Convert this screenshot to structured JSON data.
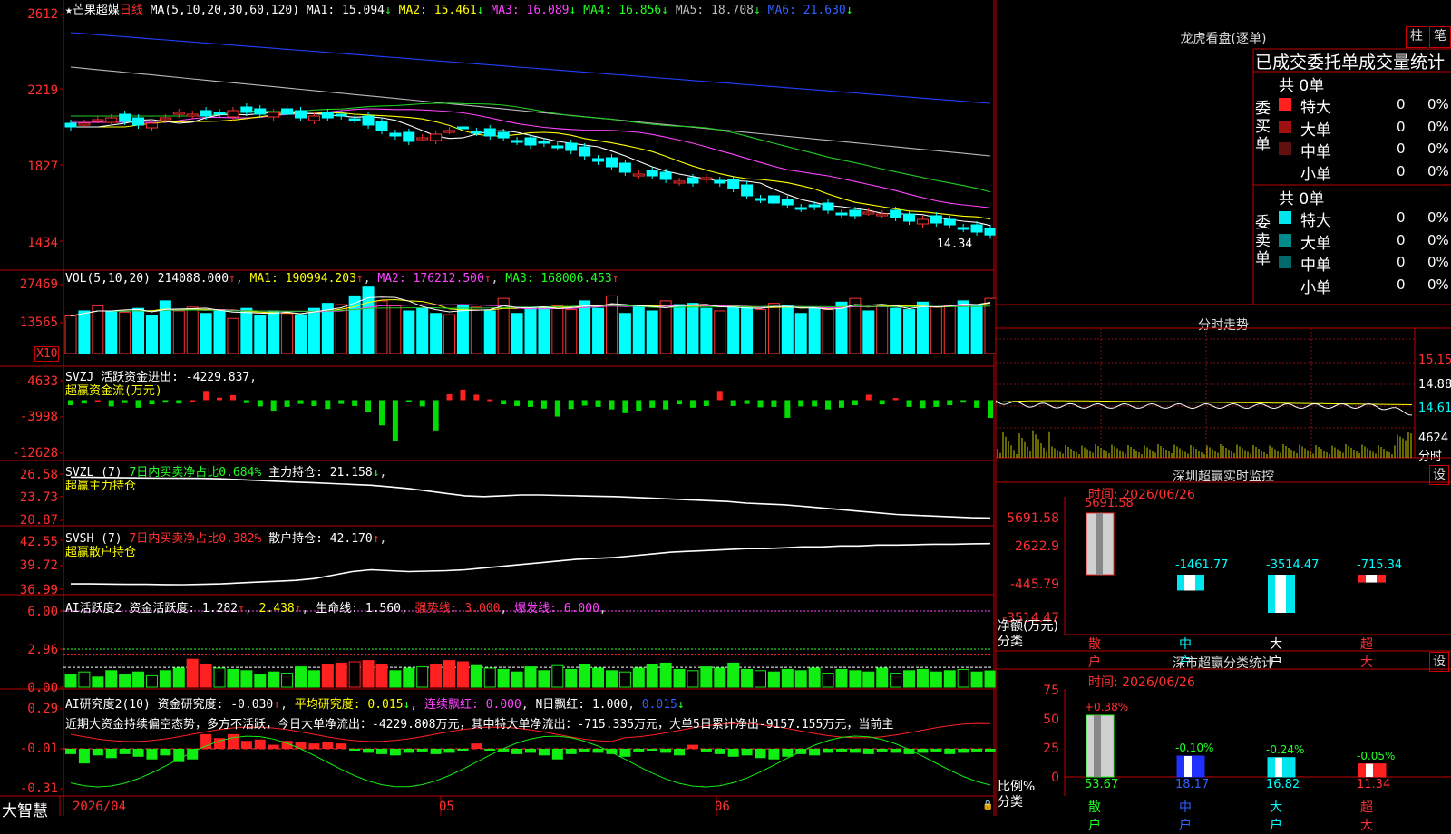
{
  "header": {
    "star": "★",
    "stock": "芒果超媒",
    "period": "日线",
    "ma_params": "MA(5,10,20,30,60,120)",
    "ma": [
      {
        "label": "MA1:",
        "value": "15.094",
        "arrow": "↓",
        "color": "#ffffff"
      },
      {
        "label": "MA2:",
        "value": "15.461",
        "arrow": "↓",
        "color": "#ffff00"
      },
      {
        "label": "MA3:",
        "value": "16.089",
        "arrow": "↓",
        "color": "#ff44ff"
      },
      {
        "label": "MA4:",
        "value": "16.856",
        "arrow": "↓",
        "color": "#22ff22"
      },
      {
        "label": "MA5:",
        "value": "18.708",
        "arrow": "↓",
        "color": "#bbbbbb"
      },
      {
        "label": "MA6:",
        "value": "21.630",
        "arrow": "↓",
        "color": "#3060ff"
      }
    ]
  },
  "price_axis": [
    "2612",
    "2219",
    "1827",
    "1434"
  ],
  "last_price_label": "14.34",
  "vol": {
    "title": "VOL(5,10,20)",
    "value": "214088.000",
    "ma1": "MA1: 190994.203",
    "ma2": "MA2: 176212.500",
    "ma3": "MA3: 168006.453",
    "axis": [
      "27469",
      "13565"
    ],
    "unit": "X10"
  },
  "svzj": {
    "title": "SVZJ",
    "line": "活跃资金进出: -4229.837",
    "sub": "超赢资金流(万元)",
    "axis": [
      "4633",
      "-3998",
      "-12628"
    ]
  },
  "svzl": {
    "title": "SVZL (7)",
    "pct": "7日内买卖净占比0.684%",
    "hold": "主力持仓: 21.158",
    "sub": "超赢主力持仓",
    "axis": [
      "26.58",
      "23.73",
      "20.87"
    ]
  },
  "svsh": {
    "title": "SVSH (7)",
    "pct": "7日内买卖净占比0.382%",
    "hold": "散户持仓: 42.170",
    "sub": "超赢散户持仓",
    "axis": [
      "42.55",
      "39.72",
      "36.99"
    ]
  },
  "ai_active": {
    "title": "AI活跃度2",
    "active": "资金活跃度: 1.282",
    "v2": "2.438",
    "life": "生命线: 1.560",
    "strong": "强势线: 3.000",
    "burst": "爆发线: 6.000",
    "axis": [
      "6.00",
      "2.96",
      "0.00"
    ]
  },
  "ai_research": {
    "title": "AI研究度2(10)",
    "research": "资金研究度: -0.030",
    "avg": "平均研究度: 0.015",
    "cont": "连续飘红: 0.000",
    "nday": "N日飘红: 1.000",
    "last": "0.015",
    "axis": [
      "0.29",
      "-0.01",
      "-0.31"
    ],
    "ticker": "近期大资金持续偏空态势，多方不活跃，今日大单净流出：-4229.808万元，其中特大单净流出：-715.335万元，大单5日累计净出-9157.155万元，当前主"
  },
  "xaxis": {
    "d1": "2026/04",
    "d2": "05",
    "d3": "06"
  },
  "logo": "大智慧",
  "right": {
    "lh_title": "龙虎看盘(逐单)",
    "btn_col": "柱",
    "btn_bi": "笔",
    "stat_title": "已成交委托单成交量统计",
    "buy_label": "委买单",
    "sell_label": "委卖单",
    "total": "共 0单",
    "buy_rows": [
      {
        "name": "特大",
        "n": "0",
        "p": "0%",
        "color": "#ff2020"
      },
      {
        "name": "大单",
        "n": "0",
        "p": "0%",
        "color": "#a01010"
      },
      {
        "name": "中单",
        "n": "0",
        "p": "0%",
        "color": "#601010"
      },
      {
        "name": "小单",
        "n": "0",
        "p": "0%",
        "color": "#000000"
      }
    ],
    "sell_rows": [
      {
        "name": "特大",
        "n": "0",
        "p": "0%",
        "color": "#00e5ee"
      },
      {
        "name": "大单",
        "n": "0",
        "p": "0%",
        "color": "#008c8c"
      },
      {
        "name": "中单",
        "n": "0",
        "p": "0%",
        "color": "#006a6a"
      },
      {
        "name": "小单",
        "n": "0",
        "p": "0%",
        "color": "#000000"
      }
    ],
    "intraday_title": "分时走势",
    "intraday_axis": [
      "15.15",
      "14.88",
      "14.61"
    ],
    "intraday_vol": "4624",
    "intraday_vol_label": "分时",
    "monitor_title": "深圳超赢实时监控",
    "monitor_btn": "设",
    "time_label": "时间: 2026/06/26",
    "monitor_axis": [
      "5691.58",
      "2622.9",
      "-445.79",
      "-3514.47"
    ],
    "net_label": "净额(万元)",
    "class_label": "分类",
    "monitor_values": [
      {
        "cat": "散户",
        "value": "5691.58"
      },
      {
        "cat": "中户",
        "value": "-1461.77"
      },
      {
        "cat": "大户",
        "value": "-3514.47"
      },
      {
        "cat": "超大",
        "value": "-715.34"
      }
    ],
    "class_title": "深市超赢分类统计",
    "class_btn": "设",
    "class_axis": [
      "75",
      "50",
      "25",
      "0"
    ],
    "ratio_label": "比例%",
    "class_values": [
      {
        "cat": "散户",
        "pct": "53.67",
        "chg": "+0.38%"
      },
      {
        "cat": "中户",
        "pct": "18.17",
        "chg": "-0.10%"
      },
      {
        "cat": "大户",
        "pct": "16.82",
        "chg": "-0.24%"
      },
      {
        "cat": "超大",
        "pct": "11.34",
        "chg": "-0.05%"
      }
    ]
  },
  "chart_data": [
    {
      "type": "candlestick",
      "title": "芒果超媒 日线",
      "ylim": [
        14.0,
        26.5
      ],
      "x_ticks": [
        "2026/04",
        "05",
        "06"
      ],
      "close": [
        20.3,
        20.5,
        20.7,
        20.8,
        20.6,
        20.4,
        20.5,
        20.8,
        21.1,
        21.0,
        20.9,
        21.0,
        21.2,
        21.1,
        21.0,
        21.1,
        21.0,
        20.8,
        20.9,
        20.8,
        20.9,
        20.7,
        20.4,
        20.1,
        19.8,
        19.5,
        19.7,
        19.9,
        20.1,
        20.2,
        20.0,
        19.8,
        19.7,
        19.5,
        19.3,
        19.4,
        19.2,
        19.0,
        18.7,
        18.4,
        18.1,
        17.8,
        17.7,
        17.6,
        17.4,
        17.3,
        17.2,
        17.5,
        17.2,
        16.9,
        16.5,
        16.3,
        16.1,
        16.0,
        15.8,
        15.9,
        15.7,
        15.5,
        15.4,
        15.6,
        15.5,
        15.3,
        15.1,
        15.2,
        15.0,
        14.9,
        14.7,
        14.5,
        14.34
      ],
      "ma": {
        "MA1": 15.094,
        "MA2": 15.461,
        "MA3": 16.089,
        "MA4": 16.856,
        "MA5": 18.708,
        "MA6": 21.63
      }
    },
    {
      "type": "bar",
      "title": "VOL(5,10,20)",
      "ylim": [
        0,
        27469
      ],
      "values": [
        15000,
        17000,
        19000,
        17000,
        16500,
        18000,
        15000,
        21000,
        17000,
        18500,
        16000,
        17500,
        14000,
        18000,
        15000,
        17000,
        16000,
        15500,
        18000,
        20000,
        19500,
        23000,
        26500,
        21000,
        19000,
        17000,
        18000,
        16000,
        15500,
        19000,
        18500,
        17000,
        22000,
        16000,
        18000,
        18500,
        19000,
        17500,
        21000,
        18000,
        23000,
        16000,
        19000,
        17000,
        21000,
        19500,
        20000,
        18000,
        17000,
        19000,
        18500,
        17500,
        20000,
        19000,
        16000,
        18000,
        17500,
        20500,
        22000,
        17000,
        19000,
        18000,
        17500,
        20500,
        18500,
        19000,
        21000,
        19500,
        22000
      ]
    },
    {
      "type": "bar",
      "title": "SVZJ 超赢资金流(万元)",
      "ylim": [
        -12628,
        4633
      ],
      "values": [
        -1200,
        -800,
        0,
        -1500,
        -700,
        -1800,
        -1000,
        -600,
        -800,
        0,
        2200,
        600,
        1200,
        -700,
        -1500,
        -2500,
        -1600,
        -900,
        -1400,
        -2100,
        -900,
        -1400,
        -2700,
        -6000,
        -9800,
        -400,
        -1500,
        -7200,
        1400,
        2500,
        1300,
        200,
        -1000,
        -1400,
        -1600,
        -2000,
        -3900,
        -2100,
        -1300,
        -1600,
        -2200,
        -3100,
        -2500,
        -1800,
        -2200,
        -1000,
        -1800,
        -1400,
        2200,
        -1400,
        -900,
        -1700,
        -1600,
        -4200,
        -1500,
        -1500,
        -2200,
        -1800,
        -1200,
        1300,
        -1000,
        500,
        -1600,
        -1900,
        -1600,
        -1200,
        -600,
        -1800,
        -4230
      ]
    },
    {
      "type": "line",
      "title": "SVZL 超赢主力持仓",
      "ylim": [
        20.87,
        26.58
      ],
      "values": [
        26.2,
        26.18,
        26.15,
        26.12,
        26.1,
        26.08,
        26.06,
        26.05,
        26.0,
        25.9,
        25.8,
        25.7,
        25.6,
        25.5,
        25.4,
        25.3,
        25.2,
        25.0,
        24.8,
        24.5,
        24.2,
        23.9,
        23.8,
        23.9,
        24.0,
        24.0,
        23.95,
        23.9,
        23.85,
        23.8,
        23.7,
        23.6,
        23.5,
        23.4,
        23.3,
        23.2,
        23.0,
        22.9,
        22.8,
        22.6,
        22.4,
        22.2,
        22.0,
        21.8,
        21.6,
        21.5,
        21.4,
        21.3,
        21.2,
        21.158
      ]
    },
    {
      "type": "line",
      "title": "SVSH 超赢散户持仓",
      "ylim": [
        36.99,
        42.55
      ],
      "values": [
        37.6,
        37.6,
        37.58,
        37.55,
        37.55,
        37.52,
        37.5,
        37.55,
        37.6,
        37.7,
        37.8,
        37.9,
        38.0,
        38.2,
        38.6,
        39.0,
        39.2,
        39.1,
        39.0,
        39.05,
        39.1,
        39.2,
        39.4,
        39.6,
        39.8,
        40.0,
        40.2,
        40.4,
        40.5,
        40.6,
        40.8,
        41.0,
        41.2,
        41.3,
        41.4,
        41.5,
        41.6,
        41.6,
        41.7,
        41.8,
        41.8,
        41.9,
        41.9,
        42.0,
        42.0,
        42.05,
        42.1,
        42.1,
        42.15,
        42.17
      ]
    },
    {
      "type": "bar",
      "title": "AI活跃度2",
      "ylim": [
        0,
        6.0
      ],
      "values": [
        1.0,
        1.2,
        0.8,
        1.3,
        1.0,
        1.2,
        0.9,
        1.3,
        1.5,
        2.2,
        1.8,
        1.5,
        1.4,
        1.3,
        1.0,
        1.2,
        1.1,
        1.6,
        1.3,
        1.8,
        1.9,
        2.0,
        2.1,
        1.8,
        1.3,
        1.5,
        1.6,
        1.8,
        2.1,
        2.0,
        1.7,
        1.5,
        1.4,
        1.2,
        1.6,
        1.3,
        1.7,
        1.4,
        1.8,
        1.5,
        1.3,
        1.2,
        1.5,
        1.8,
        1.9,
        1.4,
        1.3,
        1.6,
        1.5,
        1.9,
        1.4,
        1.3,
        1.2,
        1.4,
        1.3,
        1.5,
        1.1,
        1.4,
        1.3,
        1.2,
        1.5,
        1.1,
        1.3,
        1.4,
        1.2,
        1.3,
        1.4,
        1.2,
        1.282
      ],
      "levels": {
        "life": 1.56,
        "strong": 3.0,
        "burst": 6.0
      }
    },
    {
      "type": "bar",
      "title": "AI研究度2(10)",
      "ylim": [
        -0.31,
        0.29
      ],
      "values": [
        -0.05,
        -0.12,
        -0.06,
        -0.08,
        -0.05,
        -0.07,
        -0.09,
        -0.06,
        -0.11,
        -0.09,
        0.1,
        0.07,
        0.1,
        0.05,
        0.06,
        0.02,
        0.05,
        0.04,
        0.03,
        0.04,
        0.03,
        -0.02,
        -0.04,
        -0.05,
        -0.06,
        -0.04,
        -0.03,
        -0.05,
        -0.04,
        -0.02,
        0.03,
        -0.02,
        -0.03,
        -0.05,
        -0.04,
        -0.06,
        -0.09,
        -0.05,
        -0.03,
        -0.04,
        -0.05,
        -0.07,
        -0.03,
        -0.02,
        -0.04,
        -0.06,
        0.02,
        -0.03,
        -0.05,
        -0.07,
        -0.06,
        -0.08,
        -0.09,
        -0.07,
        -0.05,
        -0.06,
        -0.04,
        -0.03,
        -0.04,
        -0.05,
        -0.03,
        -0.04,
        -0.05,
        -0.04,
        -0.03,
        -0.05,
        -0.04,
        -0.03,
        -0.03
      ]
    }
  ]
}
